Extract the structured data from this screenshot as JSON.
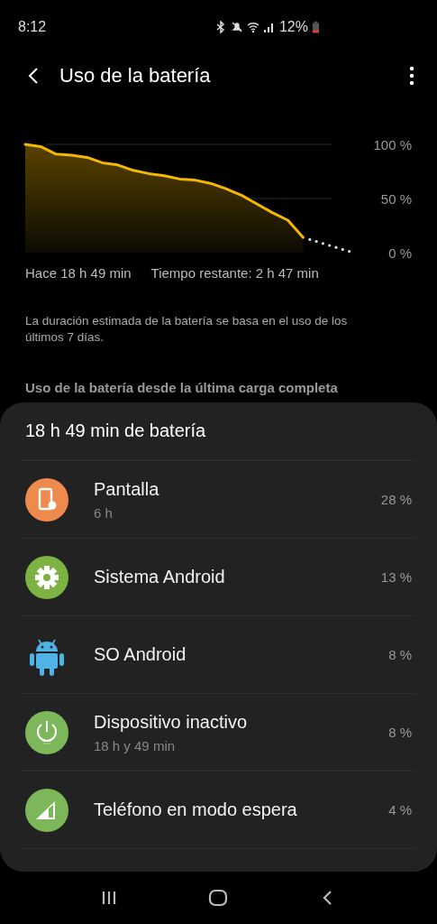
{
  "status_bar": {
    "time": "8:12",
    "battery": "12%"
  },
  "app_bar": {
    "title": "Uso de la batería"
  },
  "battery_chart": {
    "y_labels": [
      "100 %",
      "50 %",
      "0 %"
    ],
    "start_label": "Hace 18 h 49 min",
    "remaining_label": "Tiempo restante: 2 h 47 min"
  },
  "note": "La duración estimada de la batería se basa en el uso de los últimos 7 días.",
  "section_header": "Uso de la batería desde la última carga completa",
  "usage_card": {
    "title": "18 h 49 min de batería",
    "items": [
      {
        "kind": "screen",
        "color": "#ef8a4e",
        "name": "Pantalla",
        "detail": "6 h",
        "percent": "28 %"
      },
      {
        "kind": "gear",
        "color": "#7cb342",
        "name": "Sistema Android",
        "percent": "13 %"
      },
      {
        "kind": "android",
        "color": "#4fb3e8",
        "name": "SO Android",
        "percent": "8 %"
      },
      {
        "kind": "power",
        "color": "#7cb85a",
        "name": "Dispositivo inactivo",
        "detail": "18 h y 49 min",
        "percent": "8 %"
      },
      {
        "kind": "signal",
        "color": "#7cb85a",
        "name": "Teléfono en modo espera",
        "percent": "4 %"
      }
    ]
  }
}
